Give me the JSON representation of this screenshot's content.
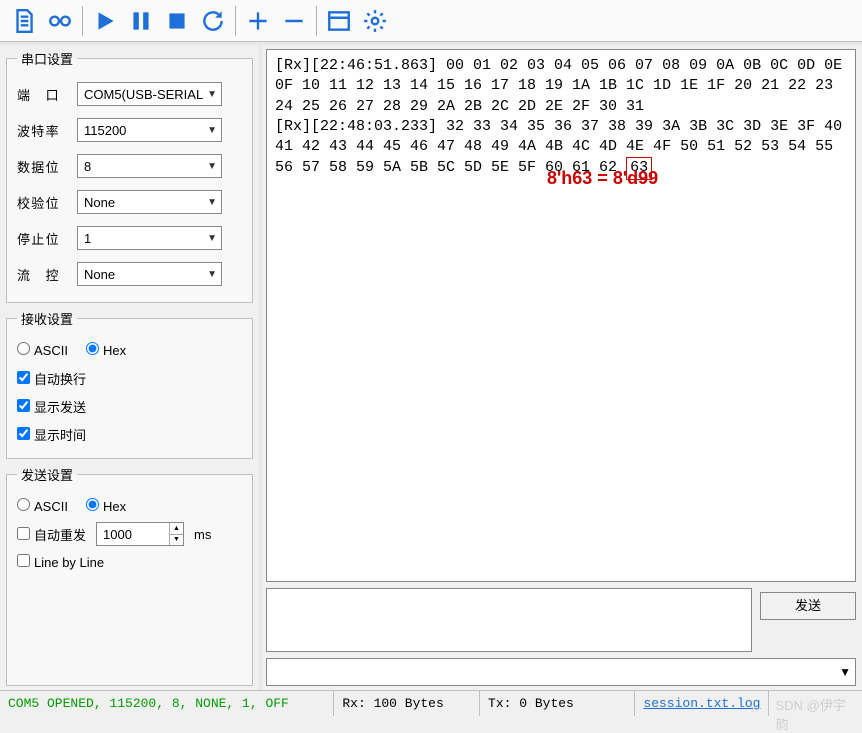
{
  "toolbar": {
    "icons": [
      "file-icon",
      "record-icon",
      "play-icon",
      "pause-icon",
      "stop-icon",
      "reload-icon",
      "plus-icon",
      "minus-icon",
      "window-icon",
      "gear-icon"
    ]
  },
  "serial": {
    "legend": "串口设置",
    "port_label": "端　口",
    "port_value": "COM5(USB-SERIAL",
    "baud_label": "波特率",
    "baud_value": "115200",
    "data_label": "数据位",
    "data_value": "8",
    "parity_label": "校验位",
    "parity_value": "None",
    "stop_label": "停止位",
    "stop_value": "1",
    "flow_label": "流　控",
    "flow_value": "None"
  },
  "recv": {
    "legend": "接收设置",
    "ascii_label": "ASCII",
    "hex_label": "Hex",
    "autowrap_label": "自动换行",
    "showsend_label": "显示发送",
    "showtime_label": "显示时间"
  },
  "send": {
    "legend": "发送设置",
    "ascii_label": "ASCII",
    "hex_label": "Hex",
    "autorepeat_label": "自动重发",
    "autorepeat_value": "1000",
    "autorepeat_unit": "ms",
    "lbl_label": "Line by Line",
    "button_label": "发送"
  },
  "rx": {
    "line1": "[Rx][22:46:51.863] 00 01 02 03 04 05 06 07 08 09 0A 0B 0C 0D 0E 0F 10 11 12 13 14 15 16 17 18 19 1A 1B 1C 1D 1E 1F 20 21 22 23 24 25 26 27 28 29 2A 2B 2C 2D 2E 2F 30 31",
    "l2a": "[Rx][22:48:03.233] 32 33 34 35 36 37 38 39 3A 3B 3C 3D 3E 3F 40 41 42 43 44 45 46 47 48 49 4A 4B 4C 4D 4E 4F 50 51 52 53 54 55 56 57 58 59 5A 5B 5C 5D 5E 5F 60 61 62 ",
    "l2b": "63",
    "annotation": "8'h63 = 8'd99"
  },
  "status": {
    "port": "COM5 OPENED, 115200, 8, NONE, 1, OFF",
    "rx": "Rx: 100 Bytes",
    "tx": "Tx: 0 Bytes",
    "log": "session.txt.log",
    "watermark": "SDN @伊宇韵"
  }
}
